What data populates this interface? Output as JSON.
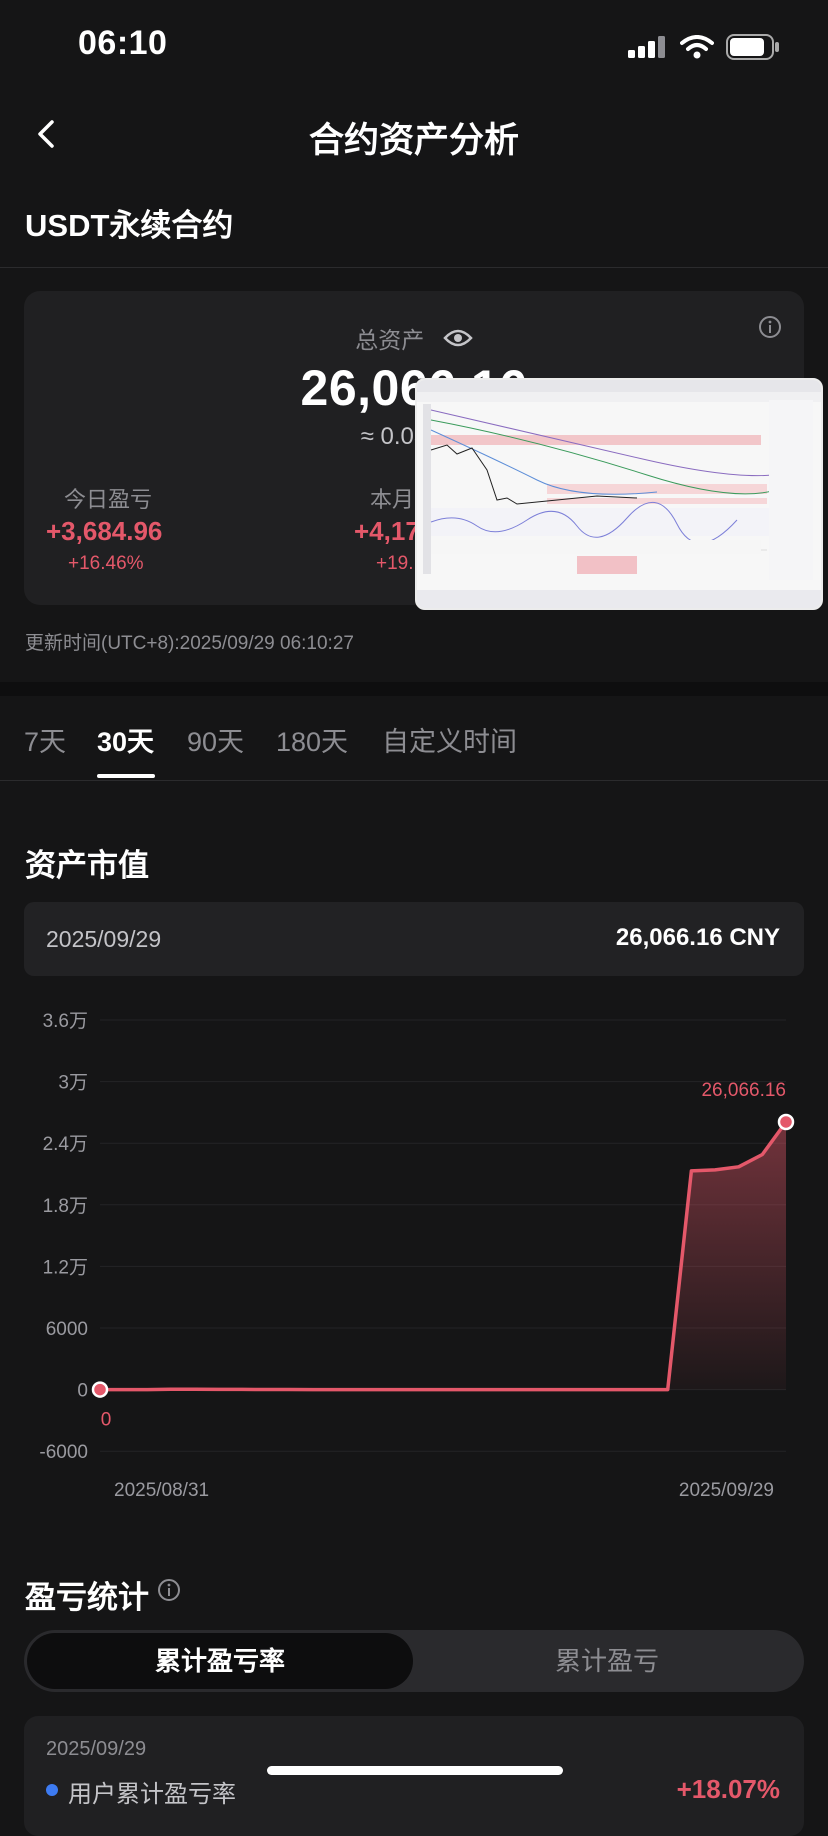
{
  "status_bar": {
    "time": "06:10"
  },
  "nav": {
    "title": "合约资产分析"
  },
  "section": {
    "title": "USDT永续合约"
  },
  "asset_card": {
    "total_label": "总资产",
    "total_value": "26,066.16",
    "approx_value": "≈ 0.03248",
    "today": {
      "label": "今日盈亏",
      "value": "+3,684.96",
      "pct": "+16.46%"
    },
    "month": {
      "label": "本月",
      "value": "+4,17",
      "pct": "+19."
    }
  },
  "update_time": "更新时间(UTC+8):2025/09/29 06:10:27",
  "tabs": [
    {
      "label": "7天",
      "active": false
    },
    {
      "label": "30天",
      "active": true
    },
    {
      "label": "90天",
      "active": false
    },
    {
      "label": "180天",
      "active": false
    },
    {
      "label": "自定义时间",
      "active": false
    }
  ],
  "chart_section": {
    "title": "资产市值",
    "tooltip": {
      "date": "2025/09/29",
      "value": "26,066.16 CNY"
    }
  },
  "chart_data": {
    "type": "area",
    "title": "",
    "xlabel": "",
    "ylabel": "",
    "y_ticks": [
      "3.6万",
      "3万",
      "2.4万",
      "1.8万",
      "1.2万",
      "6000",
      "0",
      "-6000"
    ],
    "y_tick_values": [
      36000,
      30000,
      24000,
      18000,
      12000,
      6000,
      0,
      -6000
    ],
    "ylim": [
      -6000,
      36000
    ],
    "x_labels": [
      "2025/08/31",
      "2025/09/29"
    ],
    "x": [
      "2025/08/31",
      "2025/09/01",
      "2025/09/02",
      "2025/09/03",
      "2025/09/04",
      "2025/09/05",
      "2025/09/06",
      "2025/09/07",
      "2025/09/08",
      "2025/09/09",
      "2025/09/10",
      "2025/09/11",
      "2025/09/12",
      "2025/09/13",
      "2025/09/14",
      "2025/09/15",
      "2025/09/16",
      "2025/09/17",
      "2025/09/18",
      "2025/09/19",
      "2025/09/20",
      "2025/09/21",
      "2025/09/22",
      "2025/09/23",
      "2025/09/24",
      "2025/09/25",
      "2025/09/26",
      "2025/09/27",
      "2025/09/28",
      "2025/09/29"
    ],
    "values": [
      0,
      0,
      0,
      40,
      30,
      20,
      20,
      10,
      10,
      0,
      0,
      0,
      0,
      0,
      0,
      0,
      0,
      0,
      0,
      0,
      0,
      0,
      0,
      0,
      0,
      21300,
      21400,
      21700,
      22900,
      26066.16
    ],
    "start_label": "0",
    "end_label": "26,066.16",
    "line_color": "#e4586a",
    "grid": true
  },
  "pl_stats": {
    "title": "盈亏统计",
    "toggle_active": "累计盈亏率",
    "toggle_inactive": "累计盈亏",
    "date": "2025/09/29",
    "row_label": "用户累计盈亏率",
    "row_value": "+18.07%"
  }
}
